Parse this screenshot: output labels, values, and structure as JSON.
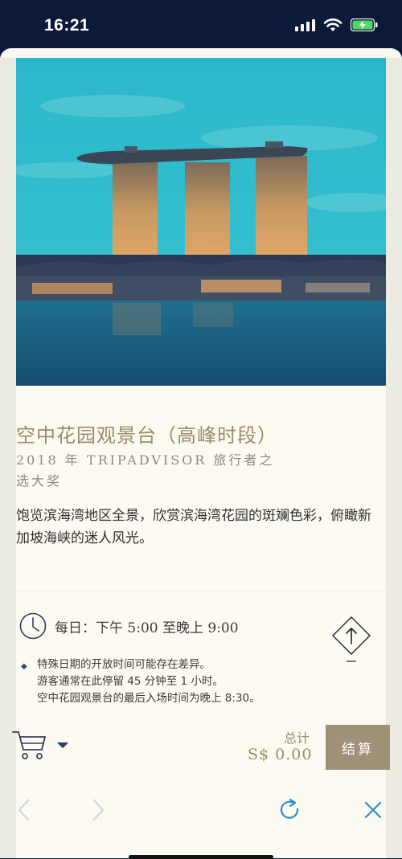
{
  "status_bar": {
    "time": "16:21"
  },
  "attraction": {
    "title": "空中花园观景台（高峰时段）",
    "award": "2018 年 TRIPADVISOR 旅行者之选大奖",
    "description": "饱览滨海湾地区全景，欣赏滨海湾花园的斑斓色彩，俯瞰新加坡海峡的迷人风光。",
    "hours": "每日：下午 5:00 至晚上 9:00",
    "notes": [
      "特殊日期的开放时间可能存在差异。",
      "游客通常在此停留 45 分钟至 1 小时。",
      "空中花园观景台的最后入场时间为晚上 8:30。"
    ]
  },
  "cart": {
    "total_label": "总计",
    "total_value": "S$ 0.00",
    "checkout_label": "结算"
  },
  "colors": {
    "accent": "#9e9178",
    "gold_text": "#9a8a6a",
    "link_blue": "#2a8ecf",
    "status_bar_bg": "#0c1a3a"
  },
  "icons": {
    "status": [
      "signal-icon",
      "wifi-icon",
      "battery-charging-icon"
    ],
    "hours": "clock-icon",
    "scroll": "arrow-up-icon",
    "cart": "cart-icon",
    "cart_toggle": "chevron-down-icon",
    "nav": [
      "back-icon",
      "forward-icon",
      "refresh-icon",
      "close-icon"
    ]
  }
}
